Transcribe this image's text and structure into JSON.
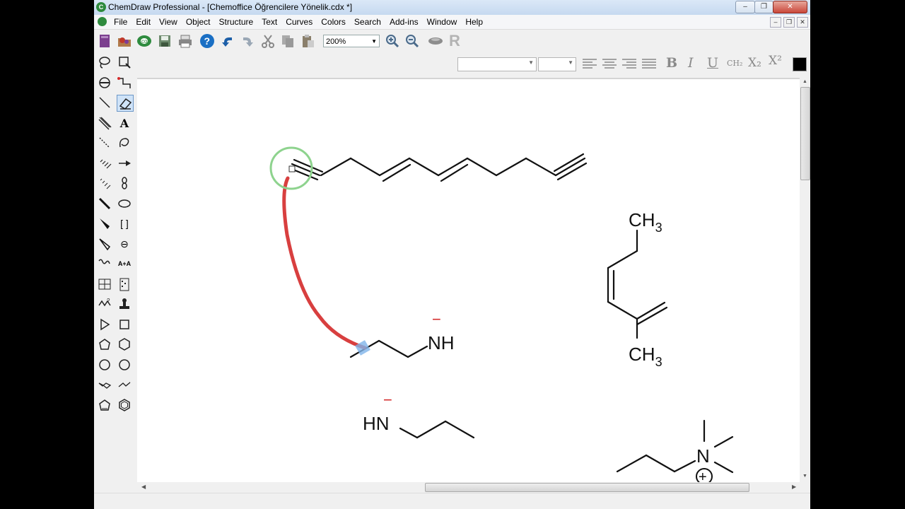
{
  "window": {
    "title": "ChemDraw Professional - [Chemoffice Öğrencilere Yönelik.cdx *]",
    "app_icon_letter": "C"
  },
  "menu": [
    "File",
    "Edit",
    "View",
    "Object",
    "Structure",
    "Text",
    "Curves",
    "Colors",
    "Search",
    "Add-ins",
    "Window",
    "Help"
  ],
  "toolbar": {
    "zoom_value": "200%",
    "template_letter": "R"
  },
  "format_bar": {
    "bold": "B",
    "italic": "I",
    "underline": "U",
    "formula": "CH₂",
    "subscript": "X₂",
    "superscript": "X²"
  },
  "palette": {
    "text_tool": "A",
    "bracket_tool": "[ ]",
    "charge_tool": "⊖",
    "atom_map_tool": "A+A"
  },
  "canvas": {
    "labels": {
      "nh_right": "NH",
      "hn_left": "HN",
      "minus": "−",
      "ch3": "CH",
      "sub3": "3",
      "n_plus": "N",
      "plus": "+"
    }
  },
  "colors": {
    "accent_red": "#d42a2a",
    "highlight_green": "#8ed38e",
    "selection_blue": "#7fb4ea"
  }
}
